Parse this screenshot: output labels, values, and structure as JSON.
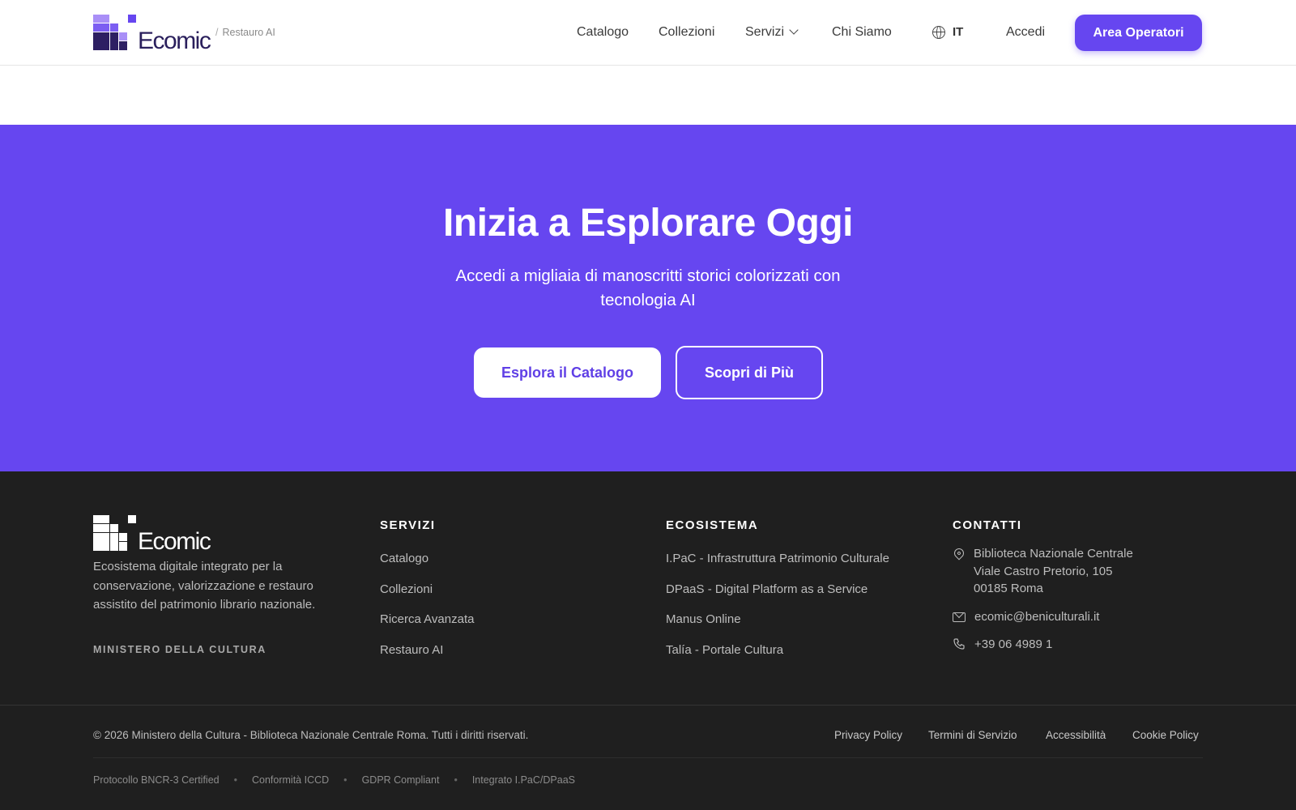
{
  "header": {
    "logo_text": "Ecomic",
    "breadcrumb_separator": "/",
    "breadcrumb": "Restauro AI",
    "nav": [
      {
        "label": "Catalogo"
      },
      {
        "label": "Collezioni"
      },
      {
        "label": "Servizi"
      },
      {
        "label": "Chi Siamo"
      }
    ],
    "language": "IT",
    "login_label": "Accedi",
    "operator_label": "Area Operatori"
  },
  "hero": {
    "title": "Inizia a Esplorare Oggi",
    "subtitle": "Accedi a migliaia di manoscritti storici colorizzati con tecnologia AI",
    "primary_button": "Esplora il Catalogo",
    "secondary_button": "Scopri di Più",
    "background_color": "#6646f0"
  },
  "footer": {
    "logo_text": "Ecomic",
    "description": "Ecosistema digitale integrato per la conservazione, valorizzazione e restauro assistito del patrimonio librario nazionale.",
    "ministry": "MINISTERO DELLA CULTURA",
    "servizi": {
      "heading": "SERVIZI",
      "links": [
        "Catalogo",
        "Collezioni",
        "Ricerca Avanzata",
        "Restauro AI"
      ]
    },
    "ecosistema": {
      "heading": "ECOSISTEMA",
      "links": [
        "I.PaC - Infrastruttura Patrimonio Culturale",
        "DPaaS - Digital Platform as a Service",
        "Manus Online",
        "Talía - Portale Cultura"
      ]
    },
    "contatti": {
      "heading": "CONTATTI",
      "address_line1": "Biblioteca Nazionale Centrale",
      "address_line2": "Viale Castro Pretorio, 105",
      "address_line3": "00185 Roma",
      "email": "ecomic@beniculturali.it",
      "phone": "+39 06 4989 1"
    },
    "copyright": "© 2026 Ministero della Cultura - Biblioteca Nazionale Centrale Roma. Tutti i diritti riservati.",
    "legal_links": [
      "Privacy Policy",
      "Termini di Servizio",
      "Accessibilità",
      "Cookie Policy"
    ],
    "badges": [
      "Protocollo BNCR-3 Certified",
      "Conformità ICCD",
      "GDPR Compliant",
      "Integrato I.PaC/DPaaS"
    ],
    "badge_separator": "•",
    "background_color": "#1f1f1f"
  }
}
